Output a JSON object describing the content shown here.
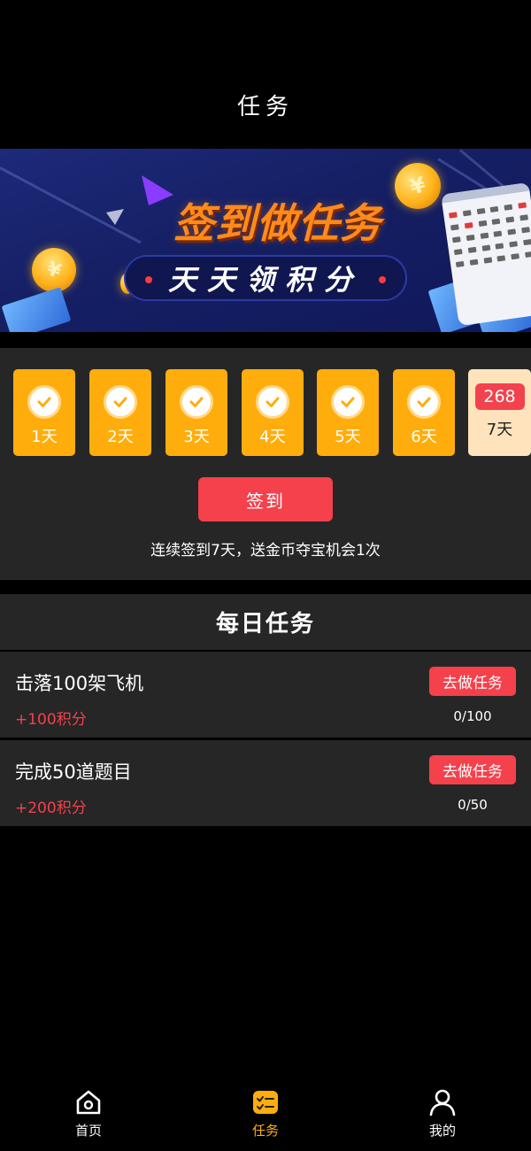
{
  "header": {
    "title": "任务"
  },
  "banner": {
    "headline": "签到做任务",
    "subline": "天天领积分",
    "coin_symbol": "¥"
  },
  "checkin": {
    "days": [
      {
        "label": "1天",
        "checked": true
      },
      {
        "label": "2天",
        "checked": true
      },
      {
        "label": "3天",
        "checked": true
      },
      {
        "label": "4天",
        "checked": true
      },
      {
        "label": "5天",
        "checked": true
      },
      {
        "label": "6天",
        "checked": true
      },
      {
        "label": "7天",
        "checked": false,
        "reward": "268"
      }
    ],
    "button_label": "签到",
    "hint": "连续签到7天，送金币夺宝机会1次"
  },
  "daily_tasks": {
    "title": "每日任务",
    "items": [
      {
        "title": "击落100架飞机",
        "reward": "+100积分",
        "button_label": "去做任务",
        "progress": "0/100"
      },
      {
        "title": "完成50道题目",
        "reward": "+200积分",
        "button_label": "去做任务",
        "progress": "0/50"
      }
    ]
  },
  "bottom_nav": {
    "items": [
      {
        "label": "首页",
        "icon": "home-icon",
        "active": false
      },
      {
        "label": "任务",
        "icon": "task-list-icon",
        "active": true
      },
      {
        "label": "我的",
        "icon": "profile-icon",
        "active": false
      }
    ]
  },
  "colors": {
    "accent_orange": "#ffad0d",
    "accent_red": "#f4414c",
    "panel": "#262626",
    "background": "#000000"
  }
}
